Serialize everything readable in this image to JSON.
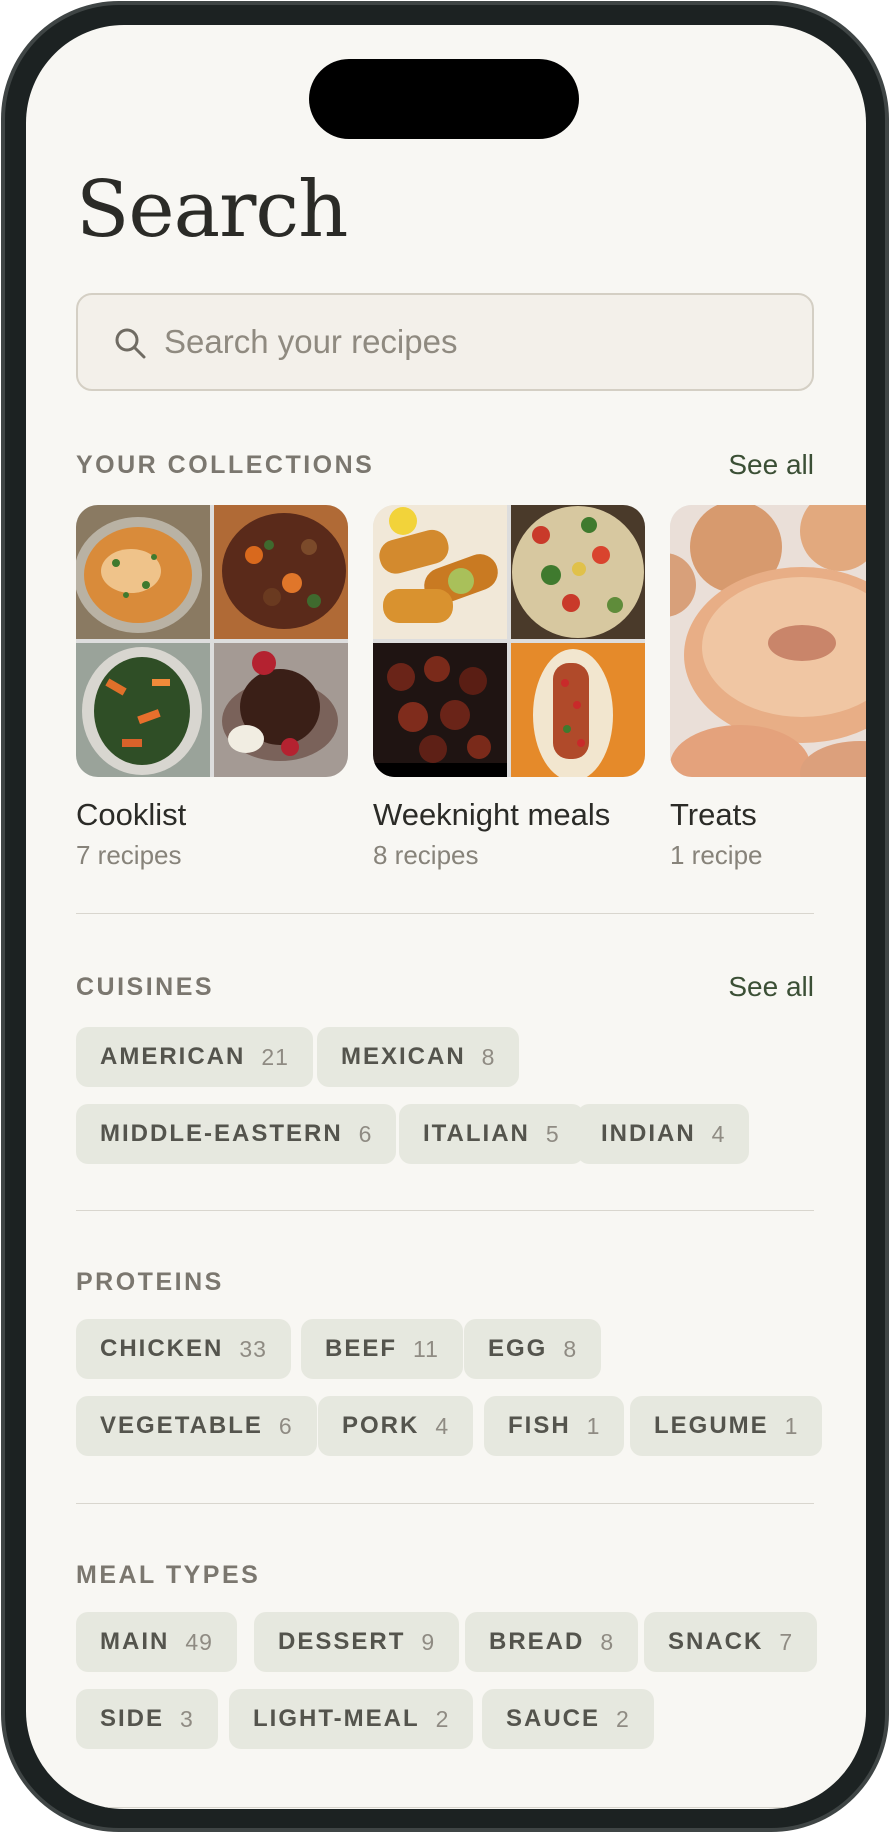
{
  "page": {
    "title": "Search"
  },
  "search": {
    "placeholder": "Search your recipes",
    "icon": "search-icon"
  },
  "collections": {
    "label": "YOUR COLLECTIONS",
    "see_all": "See all",
    "items": [
      {
        "name": "Cooklist",
        "count": "7 recipes"
      },
      {
        "name": "Weeknight meals",
        "count": "8 recipes"
      },
      {
        "name": "Treats",
        "count": "1 recipe"
      }
    ]
  },
  "cuisines": {
    "label": "CUISINES",
    "see_all": "See all",
    "rows": [
      [
        {
          "label": "AMERICAN",
          "count": "21"
        },
        {
          "label": "MEXICAN",
          "count": "8"
        }
      ],
      [
        {
          "label": "MIDDLE-EASTERN",
          "count": "6"
        },
        {
          "label": "ITALIAN",
          "count": "5"
        },
        {
          "label": "INDIAN",
          "count": "4"
        }
      ]
    ]
  },
  "proteins": {
    "label": "PROTEINS",
    "rows": [
      [
        {
          "label": "CHICKEN",
          "count": "33"
        },
        {
          "label": "BEEF",
          "count": "11"
        },
        {
          "label": "EGG",
          "count": "8"
        }
      ],
      [
        {
          "label": "VEGETABLE",
          "count": "6"
        },
        {
          "label": "PORK",
          "count": "4"
        },
        {
          "label": "FISH",
          "count": "1"
        },
        {
          "label": "LEGUME",
          "count": "1"
        }
      ]
    ]
  },
  "meal_types": {
    "label": "MEAL TYPES",
    "rows": [
      [
        {
          "label": "MAIN",
          "count": "49"
        },
        {
          "label": "DESSERT",
          "count": "9"
        },
        {
          "label": "BREAD",
          "count": "8"
        },
        {
          "label": "SNACK",
          "count": "7"
        }
      ],
      [
        {
          "label": "SIDE",
          "count": "3"
        },
        {
          "label": "LIGHT-MEAL",
          "count": "2"
        },
        {
          "label": "SAUCE",
          "count": "2"
        }
      ]
    ]
  },
  "colors": {
    "background": "#f8f7f3",
    "chip": "#e6e8df",
    "accent": "#3b4f35"
  }
}
